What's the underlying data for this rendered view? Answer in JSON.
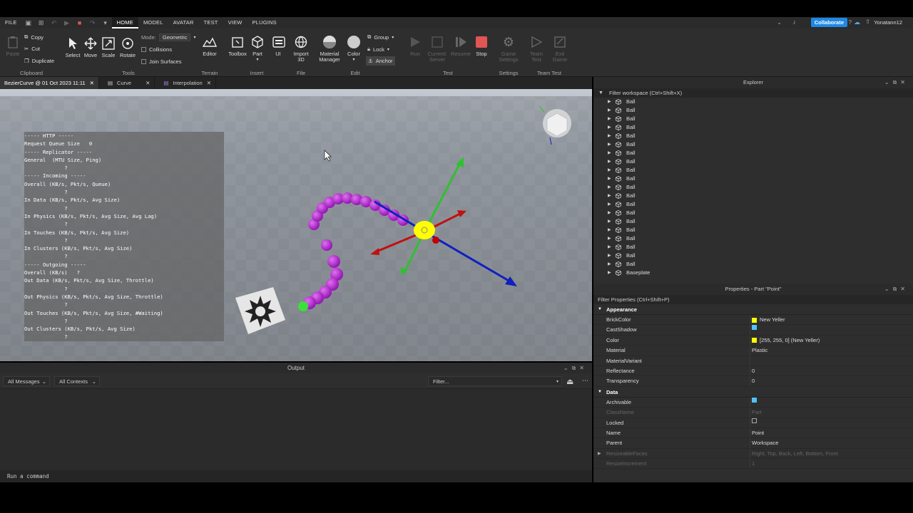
{
  "menu": {
    "items": [
      "FILE",
      "HOME",
      "MODEL",
      "AVATAR",
      "TEST",
      "VIEW",
      "PLUGINS"
    ],
    "active": "HOME"
  },
  "account": {
    "collaborate": "Collaborate",
    "username": "Yonatann12"
  },
  "ribbon": {
    "clipboard": {
      "paste": "Paste",
      "copy": "Copy",
      "cut": "Cut",
      "duplicate": "Duplicate",
      "label": "Clipboard"
    },
    "tools": {
      "select": "Select",
      "move": "Move",
      "scale": "Scale",
      "rotate": "Rotate",
      "mode_label": "Mode:",
      "mode_value": "Geometric",
      "collisions": "Collisions",
      "join_surfaces": "Join Surfaces",
      "label": "Tools"
    },
    "terrain": {
      "editor": "Editor",
      "label": "Terrain"
    },
    "insert": {
      "toolbox": "Toolbox",
      "part": "Part",
      "ui": "UI",
      "label": "Insert"
    },
    "file": {
      "import3d": "Import 3D",
      "label": "File"
    },
    "edit": {
      "material": "Material Manager",
      "color": "Color",
      "group": "Group",
      "lock": "Lock",
      "anchor": "Anchor",
      "label": "Edit"
    },
    "test": {
      "run": "Run",
      "current_server": "Current: Server",
      "resume": "Resume",
      "stop": "Stop",
      "label": "Test"
    },
    "settings": {
      "game_settings": "Game Settings",
      "label": "Settings"
    },
    "team_test": {
      "team_test": "Team Test",
      "exit_game": "Exit Game",
      "label": "Team Test"
    }
  },
  "tabs": [
    {
      "label": "BezierCurve @ 01 Oct 2023 11:11"
    },
    {
      "label": "Curve"
    },
    {
      "label": "Interpolation"
    }
  ],
  "stats": [
    "----- HTTP -----",
    "Request Queue Size   0",
    "----- Replicator -----",
    "General  (MTU Size, Ping)",
    "             ?",
    "----- Incoming -----",
    "Overall (KB/s, Pkt/s, Queue)",
    "             ?",
    "In Data (KB/s, Pkt/s, Avg Size)",
    "             ?",
    "In Physics (KB/s, Pkt/s, Avg Size, Avg Lag)",
    "             ?",
    "In Touches (KB/s, Pkt/s, Avg Size)",
    "             ?",
    "In Clusters (KB/s, Pkt/s, Avg Size)",
    "             ?",
    "----- Outgoing -----",
    "Overall (KB/s)   ?",
    "Out Data (KB/s, Pkt/s, Avg Size, Throttle)",
    "             ?",
    "Out Physics (KB/s, Pkt/s, Avg Size, Throttle)",
    "             ?",
    "Out Touches (KB/s, Pkt/s, Avg Size, #Waiting)",
    "             ?",
    "Out Clusters (KB/s, Pkt/s, Avg Size)",
    "             ?"
  ],
  "output": {
    "title": "Output",
    "messages_filter": "All Messages",
    "contexts_filter": "All Contexts",
    "filter_placeholder": "Filter..."
  },
  "command_bar": {
    "placeholder": "Run a command"
  },
  "explorer": {
    "title": "Explorer",
    "filter": "Filter workspace (Ctrl+Shift+X)",
    "items": [
      "Ball",
      "Ball",
      "Ball",
      "Ball",
      "Ball",
      "Ball",
      "Ball",
      "Ball",
      "Ball",
      "Ball",
      "Ball",
      "Ball",
      "Ball",
      "Ball",
      "Ball",
      "Ball",
      "Ball",
      "Ball",
      "Ball",
      "Ball",
      "Baseplate"
    ]
  },
  "properties": {
    "title": "Properties - Part \"Point\"",
    "filter": "Filter Properties (Ctrl+Shift+P)",
    "sections": {
      "appearance": "Appearance",
      "data": "Data"
    },
    "appearance": [
      {
        "k": "BrickColor",
        "v": "New Yeller",
        "type": "swatch"
      },
      {
        "k": "CastShadow",
        "v": "",
        "type": "check-on"
      },
      {
        "k": "Color",
        "v": "[255, 255, 0] (New Yeller)",
        "type": "swatch"
      },
      {
        "k": "Material",
        "v": "Plastic",
        "type": "text"
      },
      {
        "k": "MaterialVariant",
        "v": "",
        "type": "text"
      },
      {
        "k": "Reflectance",
        "v": "0",
        "type": "text"
      },
      {
        "k": "Transparency",
        "v": "0",
        "type": "text"
      }
    ],
    "data": [
      {
        "k": "Archivable",
        "v": "",
        "type": "check-on"
      },
      {
        "k": "ClassName",
        "v": "Part",
        "type": "dim"
      },
      {
        "k": "Locked",
        "v": "",
        "type": "check-off"
      },
      {
        "k": "Name",
        "v": "Point",
        "type": "text"
      },
      {
        "k": "Parent",
        "v": "Workspace",
        "type": "text"
      },
      {
        "k": "ResizeableFaces",
        "v": "Right, Top, Back, Left, Bottom, Front",
        "type": "dim"
      },
      {
        "k": "ResizeIncrement",
        "v": "1",
        "type": "dim"
      }
    ]
  },
  "colors": {
    "accent": "#1e88e5",
    "highlight": "#ffff00",
    "ball": "#b020d0",
    "stop": "#e05555"
  }
}
